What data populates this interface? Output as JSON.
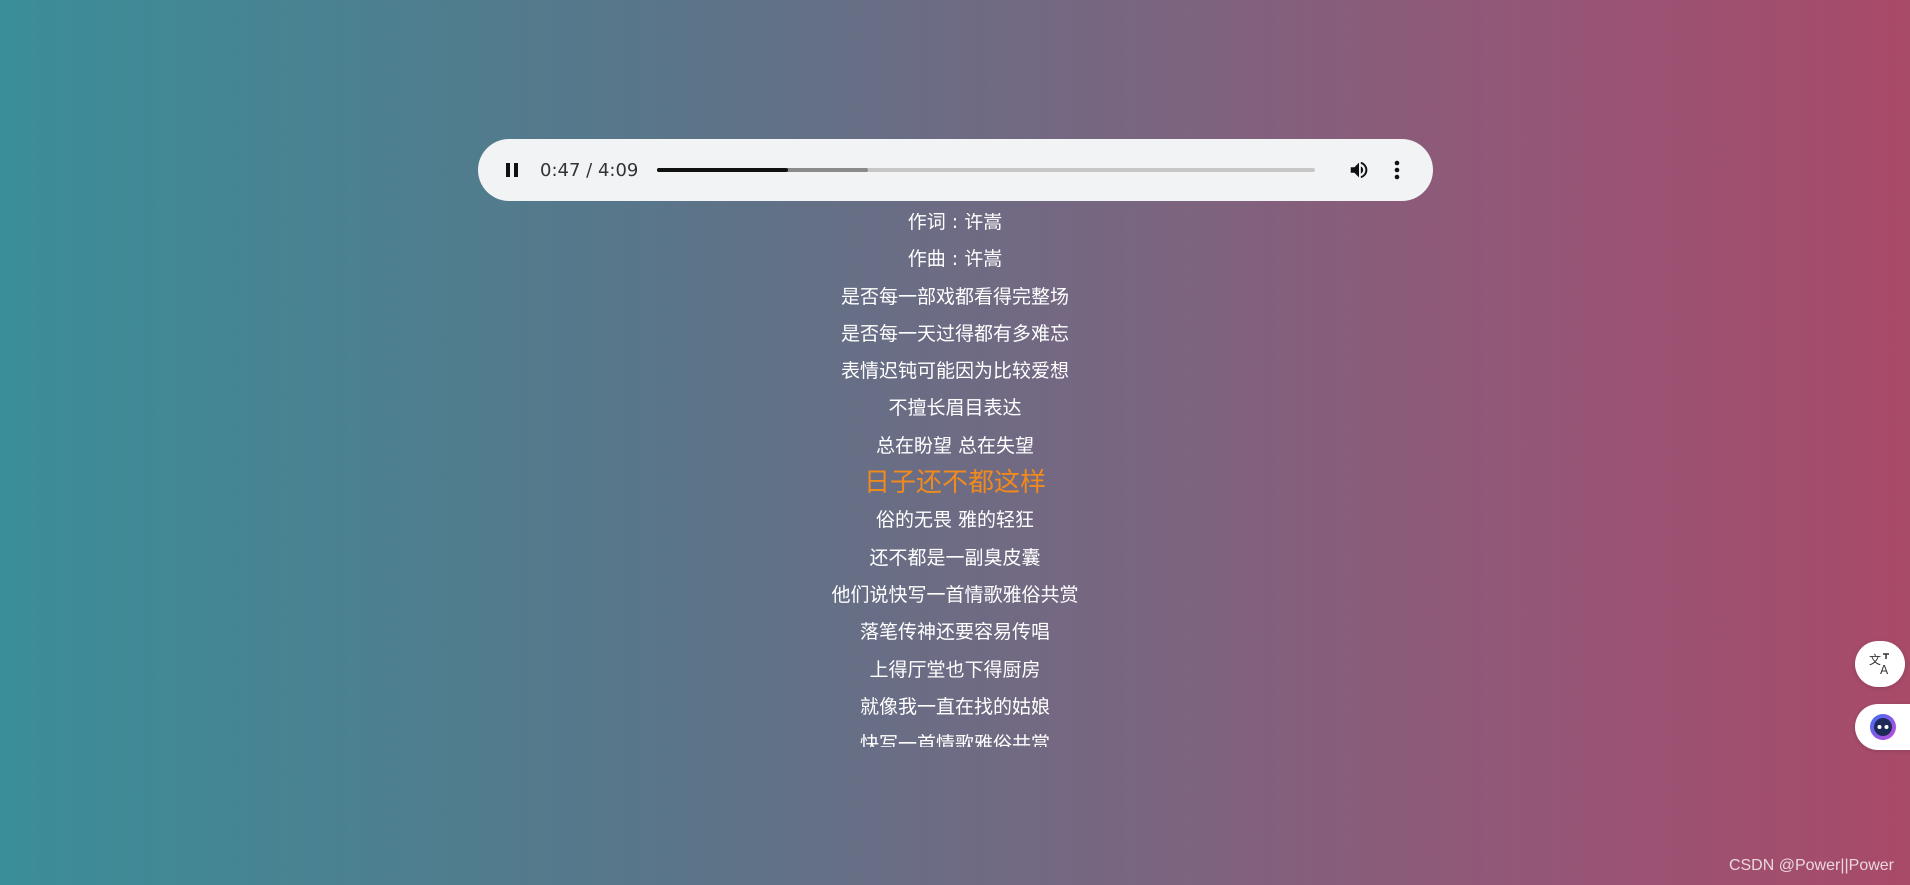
{
  "player": {
    "current_time": "0:47",
    "separator": " / ",
    "duration": "4:09",
    "played_fraction": 0.198,
    "buffered_fraction": 0.32,
    "icons": {
      "play_state": "pause-icon",
      "volume": "volume-icon",
      "menu": "more-vert-icon"
    }
  },
  "lyrics": {
    "active_index": 6,
    "active_color": "#f08a1c",
    "lines": [
      "作词 : 许嵩",
      "作曲 : 许嵩",
      "是否每一部戏都看得完整场",
      "是否每一天过得都有多难忘",
      "表情迟钝可能因为比较爱想",
      "不擅长眉目表达",
      "总在盼望 总在失望",
      "日子还不都这样",
      "俗的无畏 雅的轻狂",
      "还不都是一副臭皮囊",
      "他们说快写一首情歌雅俗共赏",
      "落笔传神还要容易传唱",
      "上得厅堂也下得厨房",
      "就像我一直在找的姑娘",
      "快写一首情歌雅俗共赏"
    ]
  },
  "floating": {
    "translate_icon": "translate-icon",
    "assistant_icon": "assistant-icon"
  },
  "watermark": "CSDN @Power||Power"
}
